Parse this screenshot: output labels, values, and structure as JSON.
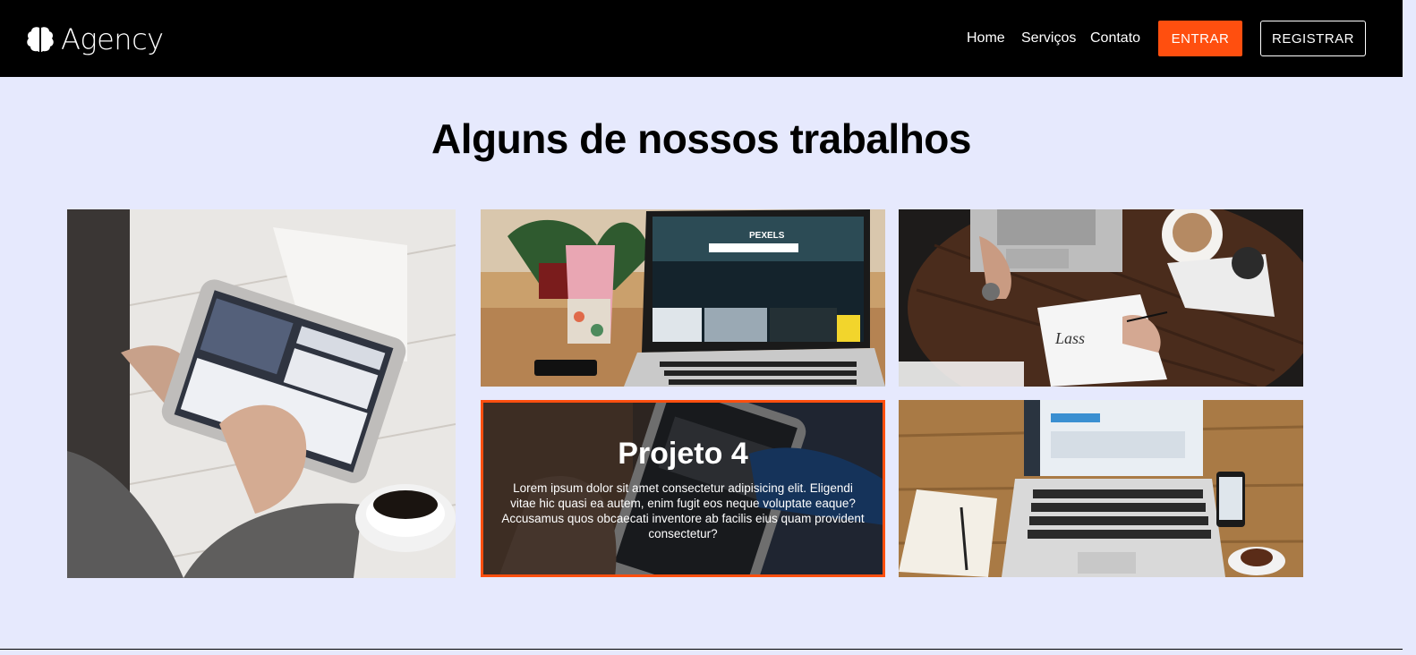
{
  "navbar": {
    "brand": "Agency",
    "links": [
      "Home",
      "Serviços",
      "Contato"
    ],
    "enter_label": "ENTRAR",
    "register_label": "REGISTRAR",
    "accent_color": "#ff4f0f"
  },
  "section": {
    "title": "Alguns de nossos trabalhos"
  },
  "projects": {
    "hovered": {
      "title": "Projeto 4",
      "description": "Lorem ipsum dolor sit amet consectetur adipisicing elit. Eligendi vitae hic quasi ea autem, enim fugit eos neque voluptate eaque? Accusamus quos obcaecati inventore ab facilis eius quam provident consectetur?"
    },
    "tile2_screen_text": "PEXELS"
  },
  "icons": {
    "logo": "brain-icon"
  }
}
